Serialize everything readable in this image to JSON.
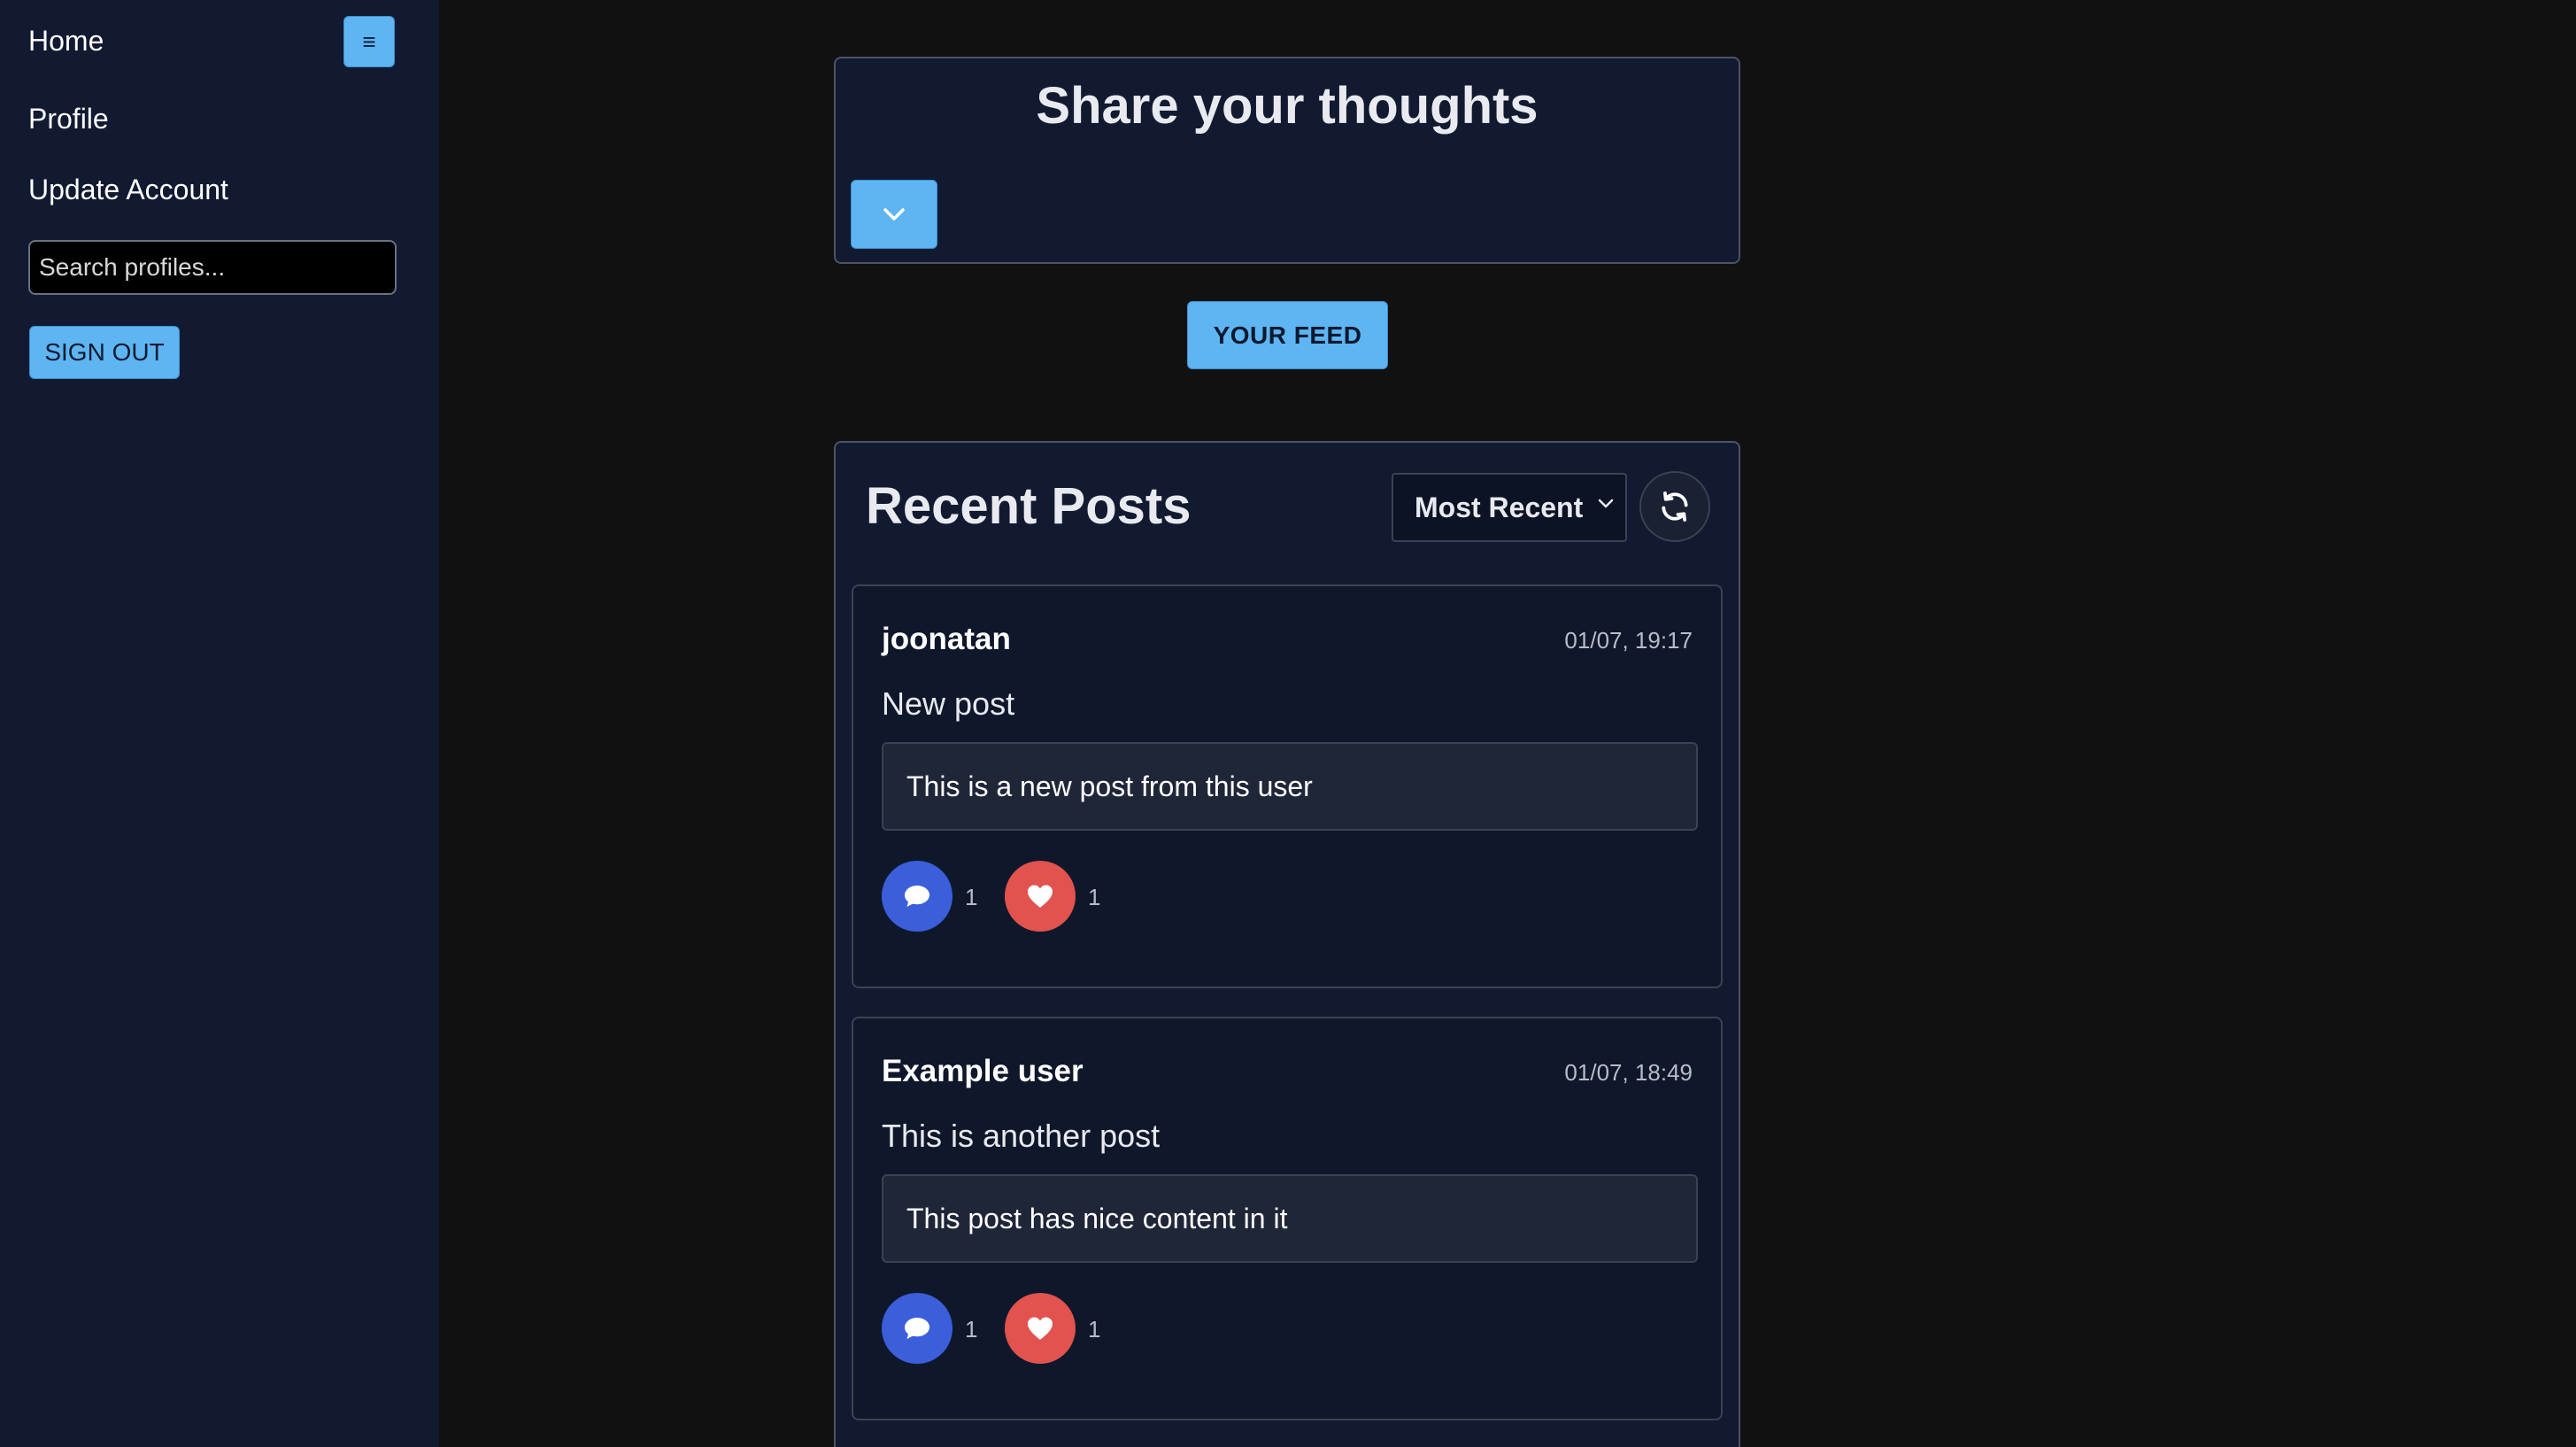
{
  "sidebar": {
    "items": [
      {
        "label": "Home"
      },
      {
        "label": "Profile"
      },
      {
        "label": "Update Account"
      }
    ],
    "menu_icon": "hamburger-icon",
    "menu_glyph": "≡",
    "search_placeholder": "Search profiles...",
    "search_value": "",
    "signout_label": "SIGN OUT"
  },
  "share": {
    "title": "Share your thoughts",
    "expand_icon": "chevron-down-icon"
  },
  "feed": {
    "button_label": "YOUR FEED"
  },
  "posts_section": {
    "title": "Recent Posts",
    "sort_selected": "Most Recent",
    "refresh_icon": "refresh-icon",
    "posts": [
      {
        "author": "joonatan",
        "time": "01/07, 19:17",
        "title": "New post",
        "body": "This is a new post from this user",
        "comments": "1",
        "likes": "1"
      },
      {
        "author": "Example user",
        "time": "01/07, 18:49",
        "title": "This is another post",
        "body": "This post has nice content in it",
        "comments": "1",
        "likes": "1"
      }
    ]
  },
  "colors": {
    "background": "#111111",
    "panel": "#111a30",
    "accent": "#5eb5f2",
    "comment": "#3b5fdb",
    "like": "#e2524f"
  }
}
